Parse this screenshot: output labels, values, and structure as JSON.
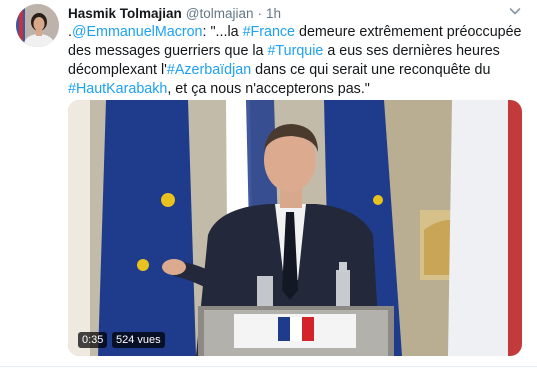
{
  "tweet": {
    "author_name": "Hasmik Tolmajian",
    "handle": "@tolmajian",
    "separator": "·",
    "time": "1h",
    "text_parts": [
      {
        "text": ".",
        "link": false
      },
      {
        "text": "@EmmanuelMacron",
        "link": true
      },
      {
        "text": ": \"...la ",
        "link": false
      },
      {
        "text": "#France",
        "link": true
      },
      {
        "text": " demeure extrêmement préoccupée des messages guerriers que la ",
        "link": false
      },
      {
        "text": "#Turquie",
        "link": true
      },
      {
        "text": " a eus ses dernières heures décomplexant l'",
        "link": false
      },
      {
        "text": "#Azerbaïdjan",
        "link": true
      },
      {
        "text": " dans ce qui serait une reconquête du ",
        "link": false
      },
      {
        "text": "#HautKarabakh",
        "link": true
      },
      {
        "text": ", et ça nous n'accepterons pas.\"",
        "link": false
      }
    ]
  },
  "media": {
    "duration": "0:35",
    "views": "524 vues"
  },
  "colors": {
    "link": "#1da1f2",
    "secondary_text": "#657786"
  },
  "icons": {
    "more": "chevron-down-icon",
    "avatar": "avatar"
  }
}
